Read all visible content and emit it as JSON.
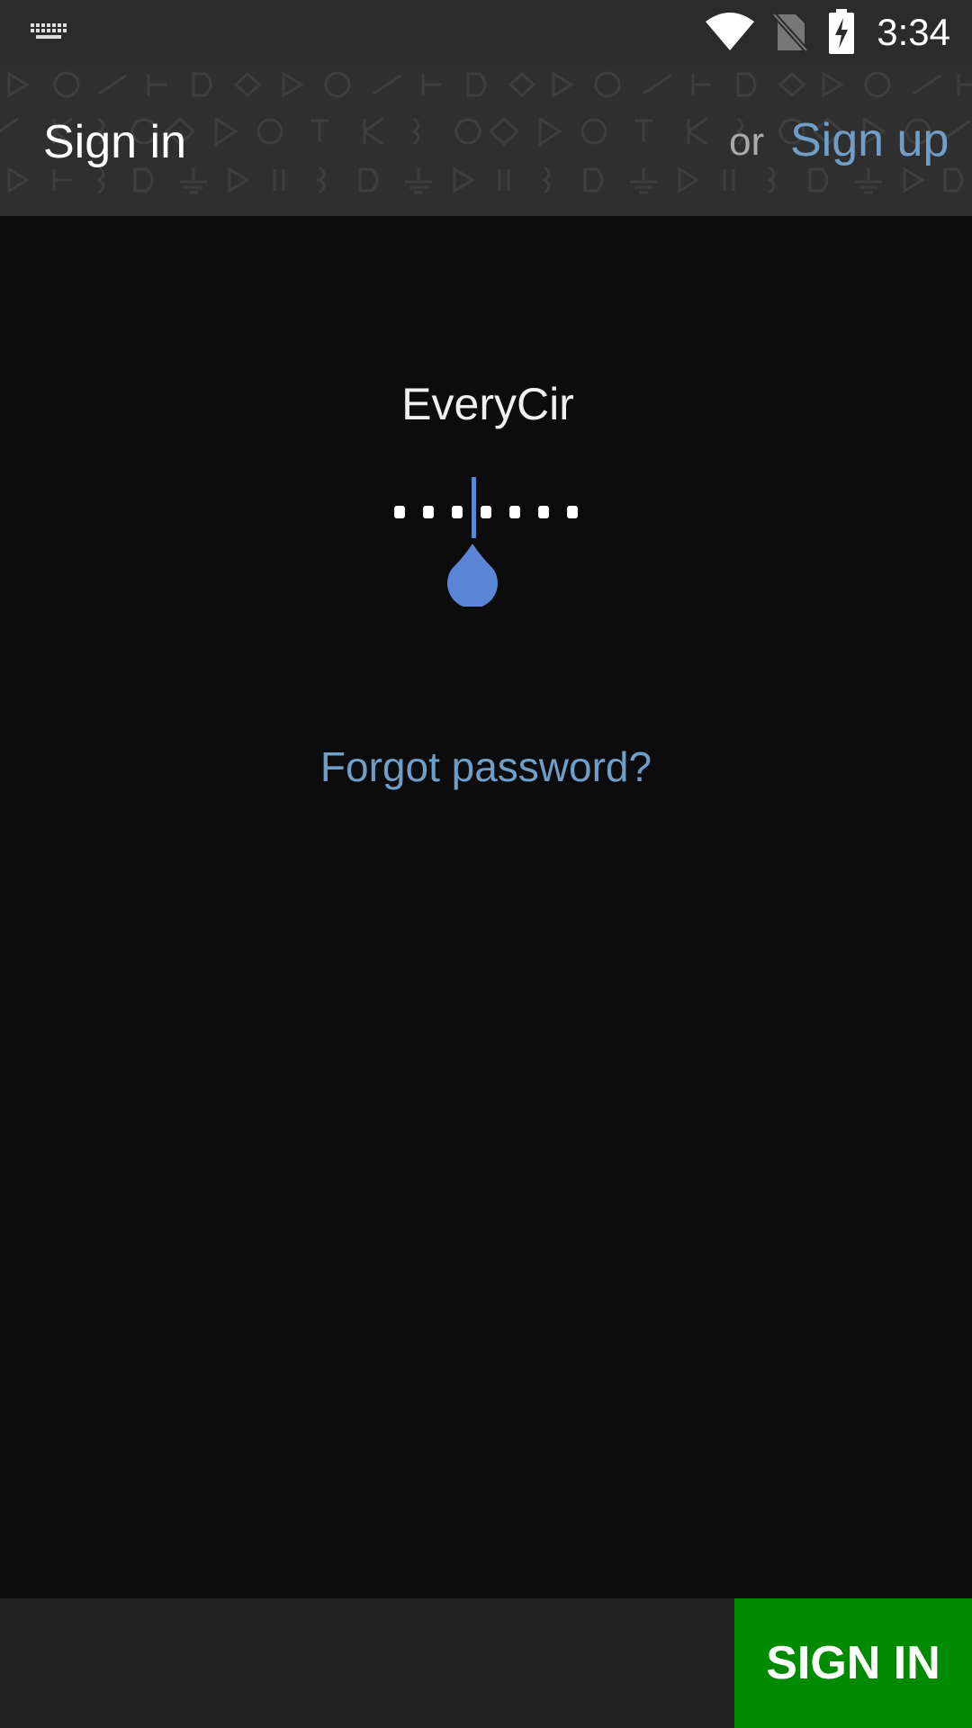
{
  "status_bar": {
    "time": "3:34",
    "icons": [
      "keyboard-icon",
      "wifi-icon",
      "no-sim-icon",
      "battery-charging-icon"
    ]
  },
  "app_bar": {
    "title": "Sign in",
    "or_text": "or",
    "signup_label": "Sign up"
  },
  "form": {
    "username_value": "EveryCir",
    "password_masked": "••••••••",
    "forgot_label": "Forgot password?"
  },
  "bottom_bar": {
    "signin_label": "SIGN IN"
  },
  "colors": {
    "background": "#0c0c0c",
    "app_bar": "#2f2f2f",
    "link": "#6f9ec9",
    "accent": "#5b86d6",
    "signin_button": "#008a00"
  }
}
